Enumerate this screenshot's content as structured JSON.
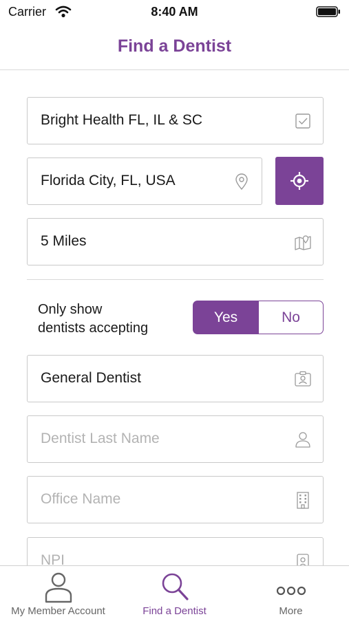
{
  "status_bar": {
    "carrier": "Carrier",
    "time": "8:40 AM"
  },
  "header": {
    "title": "Find a Dentist"
  },
  "form": {
    "plan": {
      "value": "Bright Health FL, IL & SC",
      "icon": "checkbox-icon"
    },
    "location": {
      "value": "Florida City, FL, USA",
      "icon": "map-pin-icon"
    },
    "locate_button_icon": "crosshair-icon",
    "distance": {
      "value": "5 Miles",
      "icon": "map-icon"
    },
    "accepting": {
      "label_line1": "Only show",
      "label_line2": "dentists accepting",
      "yes": "Yes",
      "no": "No",
      "selected": "Yes"
    },
    "specialty": {
      "value": "General Dentist",
      "icon": "id-card-icon"
    },
    "last_name": {
      "placeholder": "Dentist Last Name",
      "icon": "user-icon"
    },
    "office_name": {
      "placeholder": "Office Name",
      "icon": "building-icon"
    },
    "npi": {
      "placeholder": "NPI",
      "icon": "badge-icon"
    }
  },
  "tab_bar": {
    "items": [
      {
        "label": "My Member Account",
        "icon": "person-icon",
        "active": false
      },
      {
        "label": "Find a Dentist",
        "icon": "search-icon",
        "active": true
      },
      {
        "label": "More",
        "icon": "more-icon",
        "active": false
      }
    ]
  },
  "colors": {
    "accent": "#7b4397",
    "border": "#c9c9c9",
    "placeholder": "#b3b3b3"
  }
}
